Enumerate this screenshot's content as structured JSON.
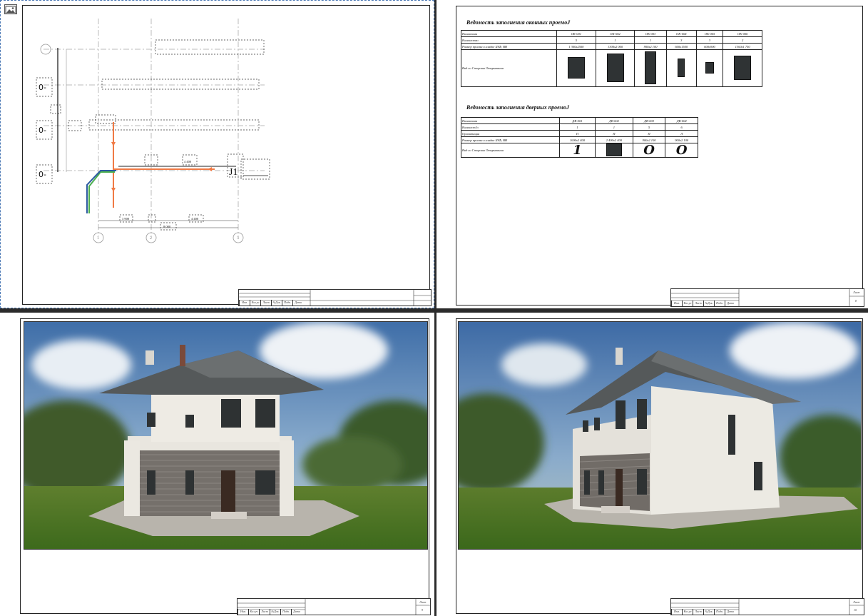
{
  "sheets": {
    "plan": {
      "axis_labels": [
        "1",
        "2",
        "3"
      ],
      "level_marks": [
        "0-",
        "0-",
        "0-"
      ],
      "dims_bottom": [
        "3 900",
        "4 400",
        "8 000"
      ],
      "dims_mid": [
        "4 400"
      ],
      "riser_label": "J1",
      "sheet_number": ""
    },
    "schedules": {
      "windows": {
        "title": "Ведомость заполнения оконных проемоJ",
        "columns": [
          "ОК-001",
          "ОК-002",
          "ОК-003",
          "ОК-004",
          "ОК-005",
          "ОК-006"
        ],
        "rows": [
          {
            "label": "Наименова",
            "values": [
              "ОК-001",
              "ОК-002",
              "ОК-003",
              "ОК-004",
              "ОК-005",
              "ОК-006"
            ]
          },
          {
            "label": "Количество",
            "values": [
              "5",
              "1",
              "1",
              "3",
              "3",
              "2"
            ]
          },
          {
            "label": "Размер проема в кладке ШФ, ВН",
            "values": [
              "1 300x2500",
              "1300x2 000",
              "900x2 100",
              "600x1500",
              "600x900",
              "1300x1 750"
            ]
          },
          {
            "label": "Вид со Стороны Открывания",
            "values": []
          }
        ]
      },
      "doors": {
        "title": "Ведомость заполнения дверных проемоJ",
        "columns": [
          "ДВ-001",
          "ДВ-002",
          "ДВ-003",
          "ДВ-004"
        ],
        "rows": [
          {
            "label": "Наименова",
            "values": [
              "ДВ-001",
              "ДВ-002",
              "ДВ-003",
              "ДВ-004"
            ]
          },
          {
            "label": "КоличестJо",
            "values": [
              "1",
              "1",
              "5",
              "6"
            ]
          },
          {
            "label": "Ориентация",
            "values": [
              "П",
              "П",
              "П",
              "Л"
            ]
          },
          {
            "label": "Размер проема в кладке ШФ, ВН",
            "values": [
              "1000x2 400",
              "2 400x2 400",
              "900x2 100",
              "900x2 100"
            ]
          },
          {
            "label": "Вид со Стороны Открывания",
            "values": [
              "1",
              "",
              "O",
              "O"
            ]
          }
        ]
      },
      "sheet_label": "Лист",
      "sheet_number": "8"
    },
    "render1": {
      "sheet_label": "Лист",
      "sheet_number": "9"
    },
    "render2": {
      "sheet_label": "Лист",
      "sheet_number": "10"
    }
  },
  "title_block_cells": [
    "Изм.",
    "Кол.уч",
    "Лист",
    "№Док.",
    "Подп.",
    "Дата"
  ],
  "colors": {
    "sheet": "#ffffff",
    "background": "#2b2b2b",
    "selection": "#4a78b5",
    "pipe_orange": "#f07a45",
    "pipe_green": "#4caf50",
    "pipe_blue": "#2c5aa0"
  },
  "icons": {
    "image_placeholder": "image-icon"
  }
}
